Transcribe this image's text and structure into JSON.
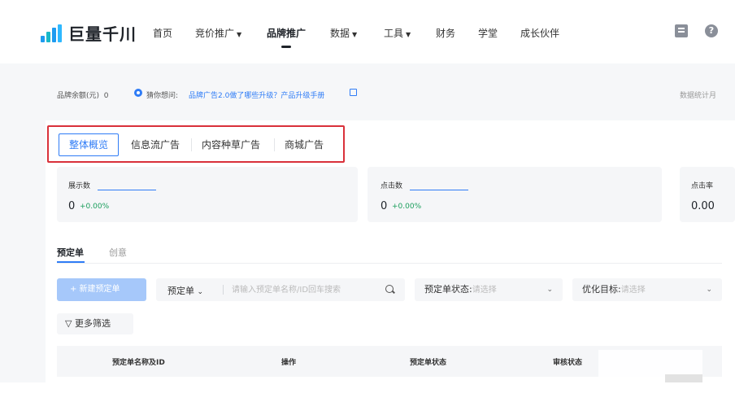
{
  "logo": {
    "text": "巨量千川"
  },
  "nav": {
    "items": [
      {
        "label": "首页",
        "caret": ""
      },
      {
        "label": "竞价推广",
        "caret": "▼"
      },
      {
        "label": "品牌推广",
        "caret": ""
      },
      {
        "label": "数据",
        "caret": "▼"
      },
      {
        "label": "工具",
        "caret": "▼"
      },
      {
        "label": "财务",
        "caret": ""
      },
      {
        "label": "学堂",
        "caret": ""
      },
      {
        "label": "成长伙伴",
        "caret": ""
      }
    ],
    "active_index": 2,
    "help_glyph": "?"
  },
  "info": {
    "balance_label": "品牌余额(元)",
    "balance_value": "0",
    "tip_prefix": "猜你想问:",
    "tip_link": "品牌广告2.0做了哪些升级？产品升级手册",
    "data_time": "数据统计月"
  },
  "tabs": [
    "整体概览",
    "信息流广告",
    "内容种草广告",
    "商城广告"
  ],
  "active_tab": 0,
  "stats": [
    {
      "label": "展示数",
      "value": "0",
      "delta": "+0.00%"
    },
    {
      "label": "点击数",
      "value": "0",
      "delta": "+0.00%"
    },
    {
      "label": "点击率",
      "value": "0.00",
      "delta": ""
    }
  ],
  "subtabs": [
    "预定单",
    "创意"
  ],
  "toolbar": {
    "new_button": "+ 新建预定单",
    "search_type": "预定单",
    "search_chevron": "⌄",
    "search_placeholder": "请输入预定单名称/ID回车搜索",
    "status_label": "预定单状态:",
    "status_placeholder": "请选择",
    "goal_label": "优化目标:",
    "goal_placeholder": "请选择",
    "chevron": "⌄",
    "more_filters": "▽ 更多筛选"
  },
  "table": {
    "columns": [
      "预定单名称及ID",
      "操作",
      "预定单状态",
      "审核状态"
    ]
  },
  "colors": {
    "primary": "#2f7cf6",
    "highlight_box": "#d9313a",
    "positive": "#1a9e5c"
  },
  "icons": [
    "logo-icon",
    "document-icon",
    "help-icon",
    "tip-icon",
    "external-link-icon",
    "search-icon",
    "filter-icon",
    "chevron-down-icon"
  ]
}
